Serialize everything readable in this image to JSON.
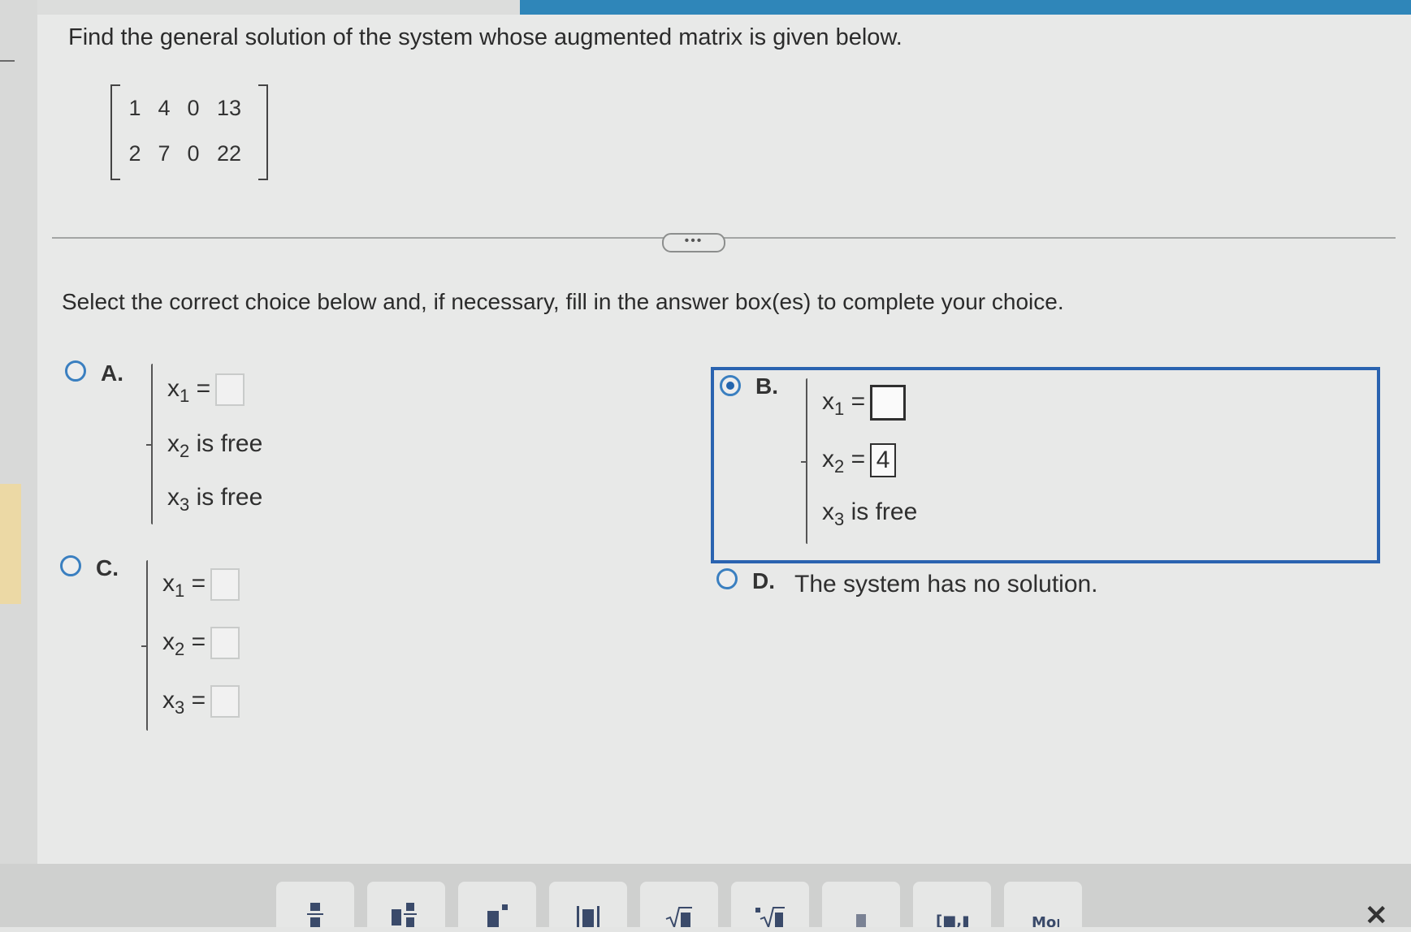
{
  "question": "Find the general solution of the system whose augmented matrix is given below.",
  "matrix": {
    "rows": [
      [
        "1",
        "4",
        "0",
        "13"
      ],
      [
        "2",
        "7",
        "0",
        "22"
      ]
    ]
  },
  "more_button": "•••",
  "instruction": "Select the correct choice below and, if necessary, fill in the answer box(es) to complete your choice.",
  "choices": {
    "a": {
      "letter": "A.",
      "selected": false,
      "x1_var": "x",
      "x1_sub": "1",
      "x1_eq": " =",
      "x2_var": "x",
      "x2_sub": "2",
      "x2_text": " is free",
      "x3_var": "x",
      "x3_sub": "3",
      "x3_text": " is free"
    },
    "b": {
      "letter": "B.",
      "selected": true,
      "x1_var": "x",
      "x1_sub": "1",
      "x1_eq": " =",
      "x2_var": "x",
      "x2_sub": "2",
      "x2_eq": " =",
      "x2_value": "4",
      "x3_var": "x",
      "x3_sub": "3",
      "x3_text": " is free"
    },
    "c": {
      "letter": "C.",
      "selected": false,
      "x1_var": "x",
      "x1_sub": "1",
      "x1_eq": " =",
      "x2_var": "x",
      "x2_sub": "2",
      "x2_eq": " =",
      "x3_var": "x",
      "x3_sub": "3",
      "x3_eq": " ="
    },
    "d": {
      "letter": "D.",
      "selected": false,
      "text": "The system has no solution."
    }
  },
  "toolbar": {
    "icons": [
      "fraction-icon",
      "mixed-number-icon",
      "exponent-icon",
      "absolute-value-icon",
      "square-root-icon",
      "nth-root-icon",
      "decimal-icon",
      "interval-icon",
      "more-symbols-icon"
    ],
    "close_label": "✕"
  },
  "colors": {
    "accent": "#2a63b0",
    "top_bar": "#2f86b9"
  }
}
